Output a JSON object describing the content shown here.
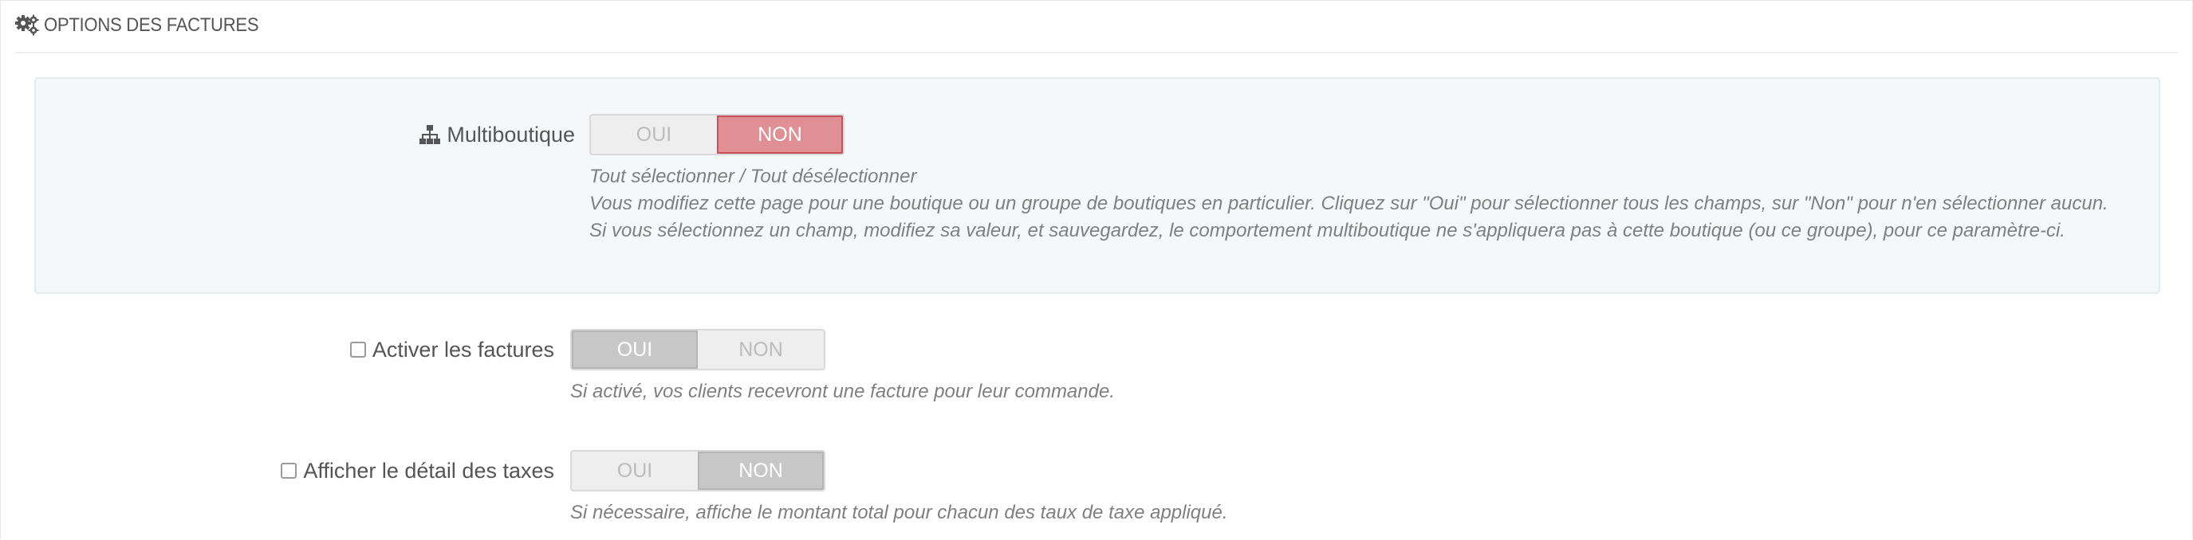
{
  "panel": {
    "title": "OPTIONS DES FACTURES",
    "icon": "gears-icon"
  },
  "multishop": {
    "label": "Multiboutique",
    "icon": "sitemap-icon",
    "switch": {
      "yes": "OUI",
      "no": "NON",
      "selected": "NON"
    },
    "help_title": "Tout sélectionner / Tout désélectionner",
    "help_line1": "Vous modifiez cette page pour une boutique ou un groupe de boutiques en particulier. Cliquez sur \"Oui\" pour sélectionner tous les champs, sur \"Non\" pour n'en sélectionner aucun.",
    "help_line2": "Si vous sélectionnez un champ, modifiez sa valeur, et sauvegardez, le comportement multiboutique ne s'appliquera pas à cette boutique (ou ce groupe), pour ce paramètre-ci."
  },
  "invoices": {
    "label": "Activer les factures",
    "checked": false,
    "switch": {
      "yes": "OUI",
      "no": "NON",
      "selected": "OUI"
    },
    "help": "Si activé, vos clients recevront une facture pour leur commande."
  },
  "tax_breakdown": {
    "label": "Afficher le détail des taxes",
    "checked": false,
    "switch": {
      "yes": "OUI",
      "no": "NON",
      "selected": "NON"
    },
    "help": "Si nécessaire, affiche le montant total pour chacun des taux de taxe appliqué."
  },
  "colors": {
    "active_red": "#e08f95",
    "active_gray": "#c7c7c7",
    "help_text": "#7f7f7f",
    "multishop_bg": "#f5f8f9"
  }
}
